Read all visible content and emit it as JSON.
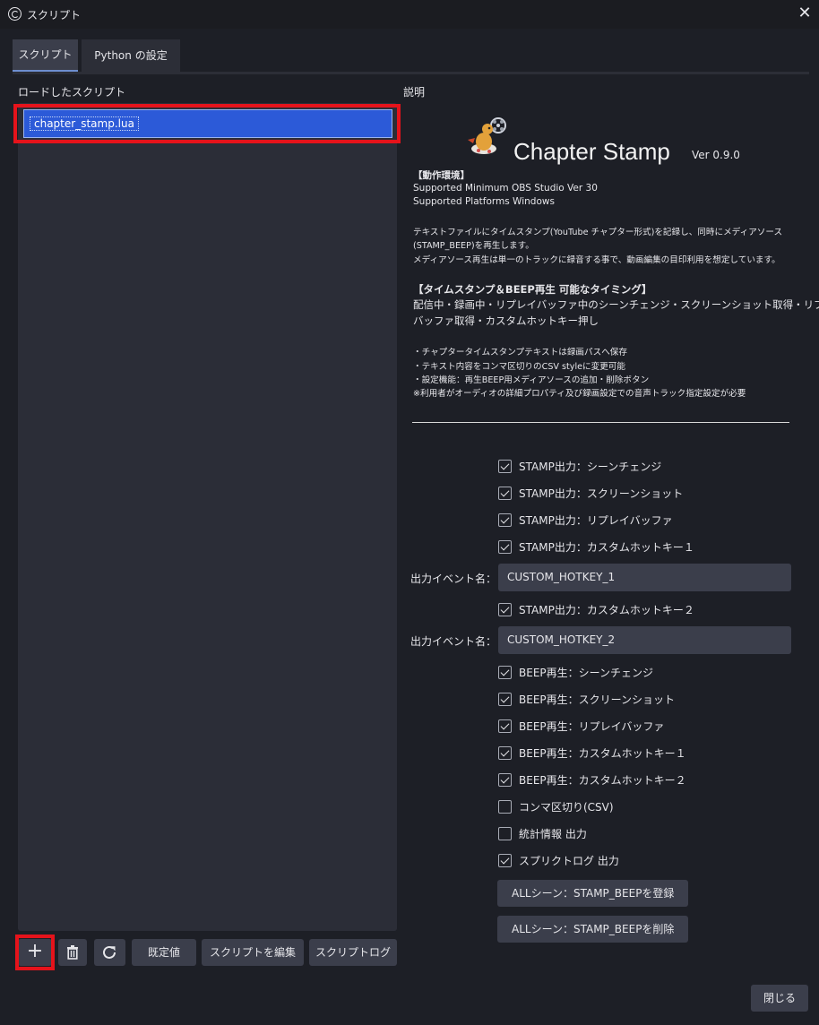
{
  "window": {
    "title": "スクリプト",
    "close_glyph": "✕"
  },
  "tabs": [
    {
      "label": "スクリプト",
      "active": true
    },
    {
      "label": "Python の設定",
      "active": false
    }
  ],
  "loaded_scripts_label": "ロードしたスクリプト",
  "scripts": [
    {
      "name": "chapter_stamp.lua",
      "selected": true
    }
  ],
  "description_label": "説明",
  "description": {
    "title": "Chapter Stamp",
    "version": "Ver 0.9.0",
    "env_heading": "【動作環境】",
    "env_lines": [
      "Supported Minimum OBS Studio Ver 30",
      "Supported Platforms Windows"
    ],
    "intro_lines": [
      "テキストファイルにタイムスタンプ(YouTube チャプター形式)を記録し、同時にメディアソース",
      "(STAMP_BEEP)を再生します。",
      "メディアソース再生は単一のトラックに録音する事で、動画編集の目印利用を想定しています。"
    ],
    "timing_heading": "【タイムスタンプ＆BEEP再生 可能なタイミング】",
    "timing_lines": [
      "配信中・録画中・リプレイバッファ中のシーンチェンジ・スクリーンショット取得・リプレイ",
      "バッファ取得・カスタムホットキー押し"
    ],
    "notes": [
      "・チャプタータイムスタンプテキストは録画パスへ保存",
      "・テキスト内容をコンマ区切りのCSV styleに変更可能",
      "・設定機能：再生BEEP用メディアソースの追加・削除ボタン",
      "※利用者がオーディオの詳細プロパティ及び録画設定での音声トラック指定設定が必要"
    ]
  },
  "options": [
    {
      "label": "STAMP出力：シーンチェンジ",
      "checked": true
    },
    {
      "label": "STAMP出力：スクリーンショット",
      "checked": true
    },
    {
      "label": "STAMP出力：リプレイバッファ",
      "checked": true
    },
    {
      "label": "STAMP出力：カスタムホットキー１",
      "checked": true
    },
    {
      "label": "STAMP出力：カスタムホットキー２",
      "checked": true
    },
    {
      "label": "BEEP再生：シーンチェンジ",
      "checked": true
    },
    {
      "label": "BEEP再生：スクリーンショット",
      "checked": true
    },
    {
      "label": "BEEP再生：リプレイバッファ",
      "checked": true
    },
    {
      "label": "BEEP再生：カスタムホットキー１",
      "checked": true
    },
    {
      "label": "BEEP再生：カスタムホットキー２",
      "checked": true
    },
    {
      "label": "コンマ区切り(CSV)",
      "checked": false
    },
    {
      "label": "統計情報 出力",
      "checked": false
    },
    {
      "label": "スプリクトログ 出力",
      "checked": true
    }
  ],
  "event_fields": [
    {
      "label": "出力イベント名：",
      "value": "CUSTOM_HOTKEY_1"
    },
    {
      "label": "出力イベント名：",
      "value": "CUSTOM_HOTKEY_2"
    }
  ],
  "actions": {
    "register": "ALLシーン：STAMP_BEEPを登録",
    "remove": "ALLシーン：STAMP_BEEPを削除"
  },
  "bottom_buttons": {
    "add_glyph": "+",
    "defaults": "既定値",
    "edit": "スクリプトを編集",
    "log": "スクリプトログ",
    "close": "閉じる"
  },
  "icons": [
    "obs-logo-icon",
    "close-icon",
    "plus-icon",
    "trash-icon",
    "reload-icon",
    "chapter-stamp-logo"
  ]
}
